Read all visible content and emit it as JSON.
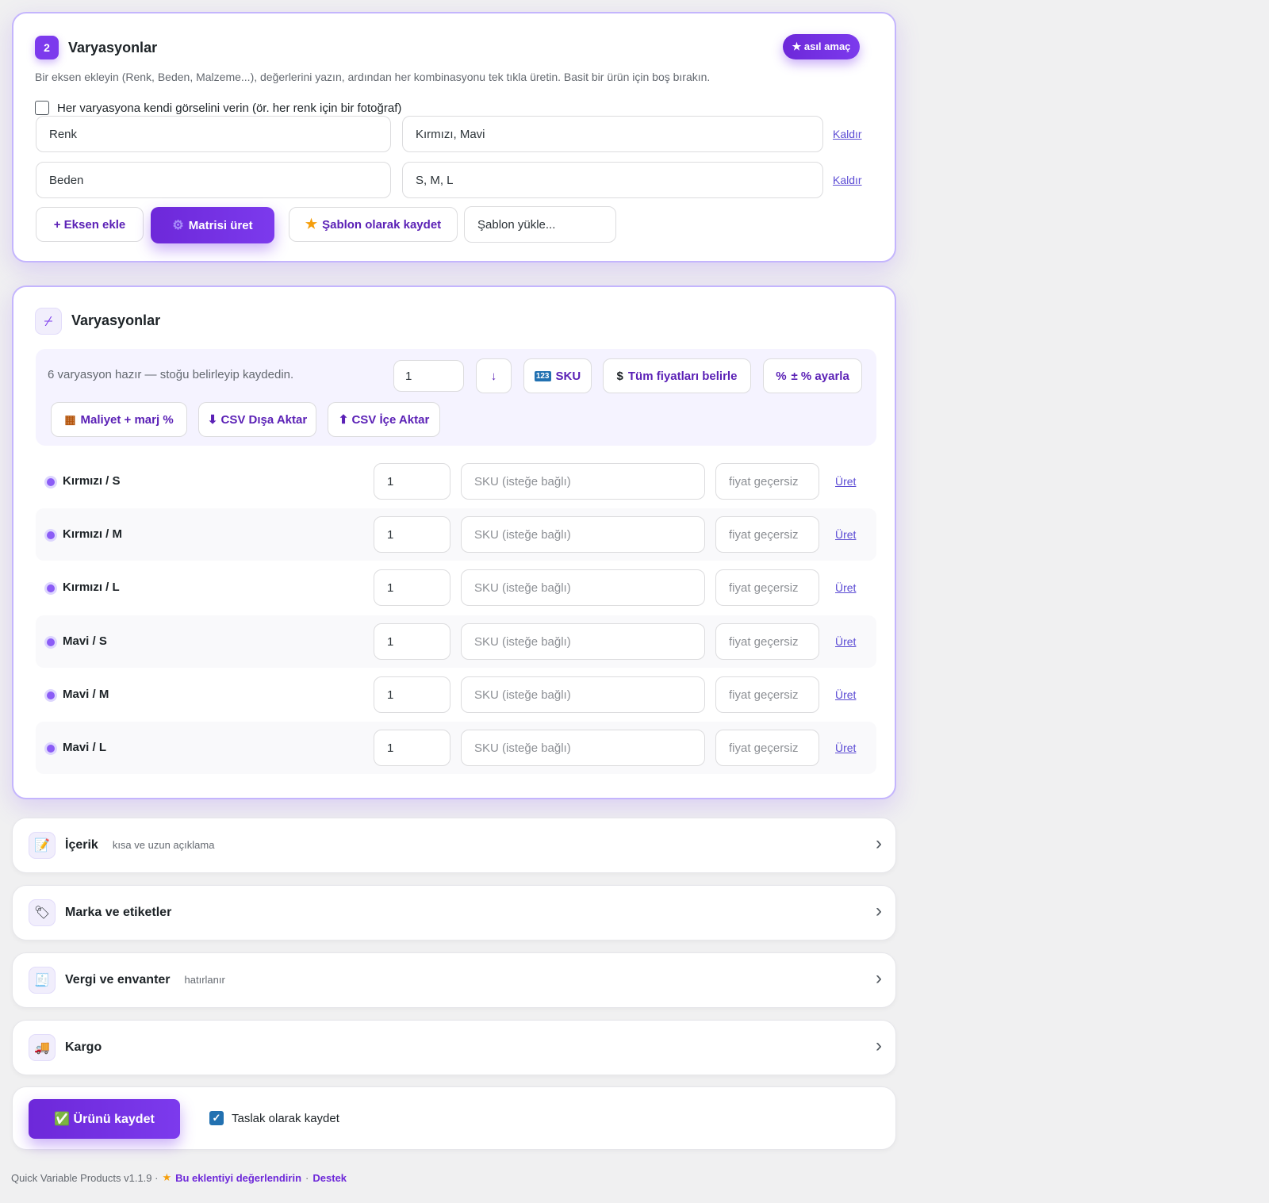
{
  "axes_card": {
    "step_number": "2",
    "title": "Varyasyonlar",
    "badge_label": "★ asıl amaç",
    "description": "Bir eksen ekleyin (Renk, Beden, Malzeme...), değerlerini yazın, ardından her kombinasyonu tek tıkla üretin. Basit bir ürün için boş bırakın.",
    "per_variation_image_label": "Her varyasyona kendi görselini verin (ör. her renk için bir fotoğraf)",
    "axes": [
      {
        "name": "Renk",
        "values": "Kırmızı, Mavi",
        "remove_label": "Kaldır"
      },
      {
        "name": "Beden",
        "values": "S, M, L",
        "remove_label": "Kaldır"
      }
    ],
    "add_axis_label": "+ Eksen ekle",
    "generate_label": "Matrisi üret",
    "save_template_label": "Şablon olarak kaydet",
    "load_template_placeholder": "Şablon yükle..."
  },
  "variations_card": {
    "title": "Varyasyonlar",
    "status_text": "6 varyasyon hazır — stoğu belirleyip kaydedin.",
    "bulk_stock_value": "1",
    "apply_down_label": "↓",
    "sku_label": "SKU",
    "set_all_prices_label": "Tüm fiyatları belirle",
    "adjust_percent_label": "± % ayarla",
    "cost_margin_label": "Maliyet + marj %",
    "csv_export_label": "⬇ CSV Dışa Aktar",
    "csv_import_label": "⬆ CSV İçe Aktar",
    "sku_placeholder": "SKU (isteğe bağlı)",
    "price_placeholder": "fiyat geçersiz",
    "generate_link": "Üret",
    "rows": [
      {
        "label": "Kırmızı / S",
        "stock": "1"
      },
      {
        "label": "Kırmızı / M",
        "stock": "1"
      },
      {
        "label": "Kırmızı / L",
        "stock": "1"
      },
      {
        "label": "Mavi / S",
        "stock": "1"
      },
      {
        "label": "Mavi / M",
        "stock": "1"
      },
      {
        "label": "Mavi / L",
        "stock": "1"
      }
    ]
  },
  "sections": [
    {
      "title": "İçerik",
      "subtitle": "kısa ve uzun açıklama",
      "icon": "memo-icon"
    },
    {
      "title": "Marka ve etiketler",
      "subtitle": "",
      "icon": "tag-icon"
    },
    {
      "title": "Vergi ve envanter",
      "subtitle": "hatırlanır",
      "icon": "receipt-icon"
    },
    {
      "title": "Kargo",
      "subtitle": "",
      "icon": "truck-icon"
    }
  ],
  "save_bar": {
    "save_label": "✅ Ürünü kaydet",
    "draft_label": "Taslak olarak kaydet",
    "draft_checked": true
  },
  "footer": {
    "version_text": "Quick Variable Products v1.1.9 ·",
    "rate_label": "Bu eklentiyi değerlendirin",
    "separator": "·",
    "support_label": "Destek"
  },
  "colors": {
    "accent": "#7c3aed",
    "accent_text": "#5b21b6",
    "card_border": "#c4b5fd",
    "background": "#f0f0f1"
  }
}
